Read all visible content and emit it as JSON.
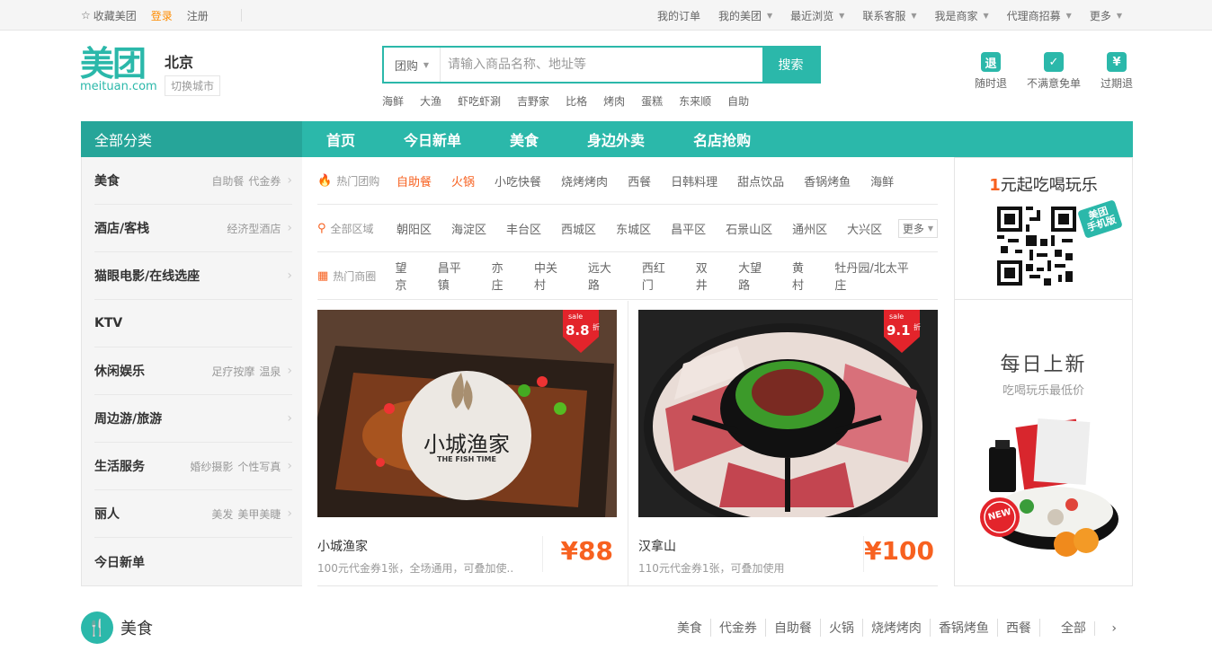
{
  "topbar": {
    "left": {
      "favorite": "收藏美团",
      "login": "登录",
      "register": "注册"
    },
    "right": [
      {
        "label": "我的订单",
        "caret": false
      },
      {
        "label": "我的美团",
        "caret": true
      },
      {
        "label": "最近浏览",
        "caret": true
      },
      {
        "label": "联系客服",
        "caret": true
      },
      {
        "label": "我是商家",
        "caret": true
      },
      {
        "label": "代理商招募",
        "caret": true
      },
      {
        "label": "更多",
        "caret": true
      }
    ]
  },
  "logo": {
    "text": "美团",
    "url": "meituan.com"
  },
  "city": {
    "name": "北京",
    "switch": "切换城市"
  },
  "search": {
    "scope": "团购",
    "placeholder": "请输入商品名称、地址等",
    "button": "搜索"
  },
  "hotwords": [
    "海鲜",
    "大渔",
    "虾吃虾涮",
    "吉野家",
    "比格",
    "烤肉",
    "蛋糕",
    "东来顺",
    "自助"
  ],
  "promises": [
    {
      "icon": "退",
      "label": "随时退"
    },
    {
      "icon": "✓",
      "label": "不满意免单"
    },
    {
      "icon": "¥",
      "label": "过期退"
    }
  ],
  "nav": {
    "all": "全部分类",
    "links": [
      "首页",
      "今日新单",
      "美食",
      "身边外卖",
      "名店抢购"
    ]
  },
  "categories": [
    {
      "name": "美食",
      "subs": [
        "自助餐",
        "代金券"
      ],
      "arrow": true
    },
    {
      "name": "酒店/客栈",
      "subs": [
        "经济型酒店"
      ],
      "arrow": true
    },
    {
      "name": "猫眼电影/在线选座",
      "subs": [],
      "arrow": true
    },
    {
      "name": "KTV",
      "subs": [],
      "arrow": false
    },
    {
      "name": "休闲娱乐",
      "subs": [
        "足疗按摩",
        "温泉"
      ],
      "arrow": true
    },
    {
      "name": "周边游/旅游",
      "subs": [],
      "arrow": true
    },
    {
      "name": "生活服务",
      "subs": [
        "婚纱摄影",
        "个性写真"
      ],
      "arrow": true
    },
    {
      "name": "丽人",
      "subs": [
        "美发",
        "美甲美睫"
      ],
      "arrow": true
    },
    {
      "name": "今日新单",
      "subs": [],
      "arrow": false
    }
  ],
  "filters": [
    {
      "label": "热门团购",
      "icon": "fire",
      "options": [
        {
          "t": "自助餐",
          "hot": true
        },
        {
          "t": "火锅",
          "hot": true
        },
        {
          "t": "小吃快餐"
        },
        {
          "t": "烧烤烤肉"
        },
        {
          "t": "西餐"
        },
        {
          "t": "日韩料理"
        },
        {
          "t": "甜点饮品"
        },
        {
          "t": "香锅烤鱼"
        },
        {
          "t": "海鲜"
        }
      ]
    },
    {
      "label": "全部区域",
      "icon": "pin",
      "options": [
        {
          "t": "朝阳区"
        },
        {
          "t": "海淀区"
        },
        {
          "t": "丰台区"
        },
        {
          "t": "西城区"
        },
        {
          "t": "东城区"
        },
        {
          "t": "昌平区"
        },
        {
          "t": "石景山区"
        },
        {
          "t": "通州区"
        },
        {
          "t": "大兴区"
        }
      ],
      "more": "更多"
    },
    {
      "label": "热门商圈",
      "icon": "building",
      "options": [
        {
          "t": "望京"
        },
        {
          "t": "昌平镇"
        },
        {
          "t": "亦庄"
        },
        {
          "t": "中关村"
        },
        {
          "t": "远大路"
        },
        {
          "t": "西红门"
        },
        {
          "t": "双井"
        },
        {
          "t": "大望路"
        },
        {
          "t": "黄村"
        },
        {
          "t": "牡丹园/北太平庄"
        }
      ]
    }
  ],
  "deals": [
    {
      "title": "小城渔家",
      "desc": "100元代金券1张，全场通用，可叠加使..",
      "price": "¥88",
      "discount": "8.8",
      "sale": "sale",
      "zhe": "折",
      "brand_cn": "小城渔家",
      "brand_en": "THE FISH TIME"
    },
    {
      "title": "汉拿山",
      "desc": "110元代金券1张，可叠加使用",
      "price": "¥100",
      "discount": "9.1",
      "sale": "sale",
      "zhe": "折"
    }
  ],
  "promo": {
    "title_num": "1",
    "title_rest": "元起吃喝玩乐",
    "qr_tag": "美团\n手机版",
    "daily": "每日上新",
    "daily_sub": "吃喝玩乐最低价",
    "new_badge": "NEW"
  },
  "section": {
    "title": "美食",
    "links": [
      "美食",
      "代金券",
      "自助餐",
      "火锅",
      "烧烤烤肉",
      "香锅烤鱼",
      "西餐"
    ],
    "all": "全部"
  },
  "colors": {
    "brand": "#2bb8aa",
    "accent": "#f76120",
    "login": "#fe8c00"
  }
}
